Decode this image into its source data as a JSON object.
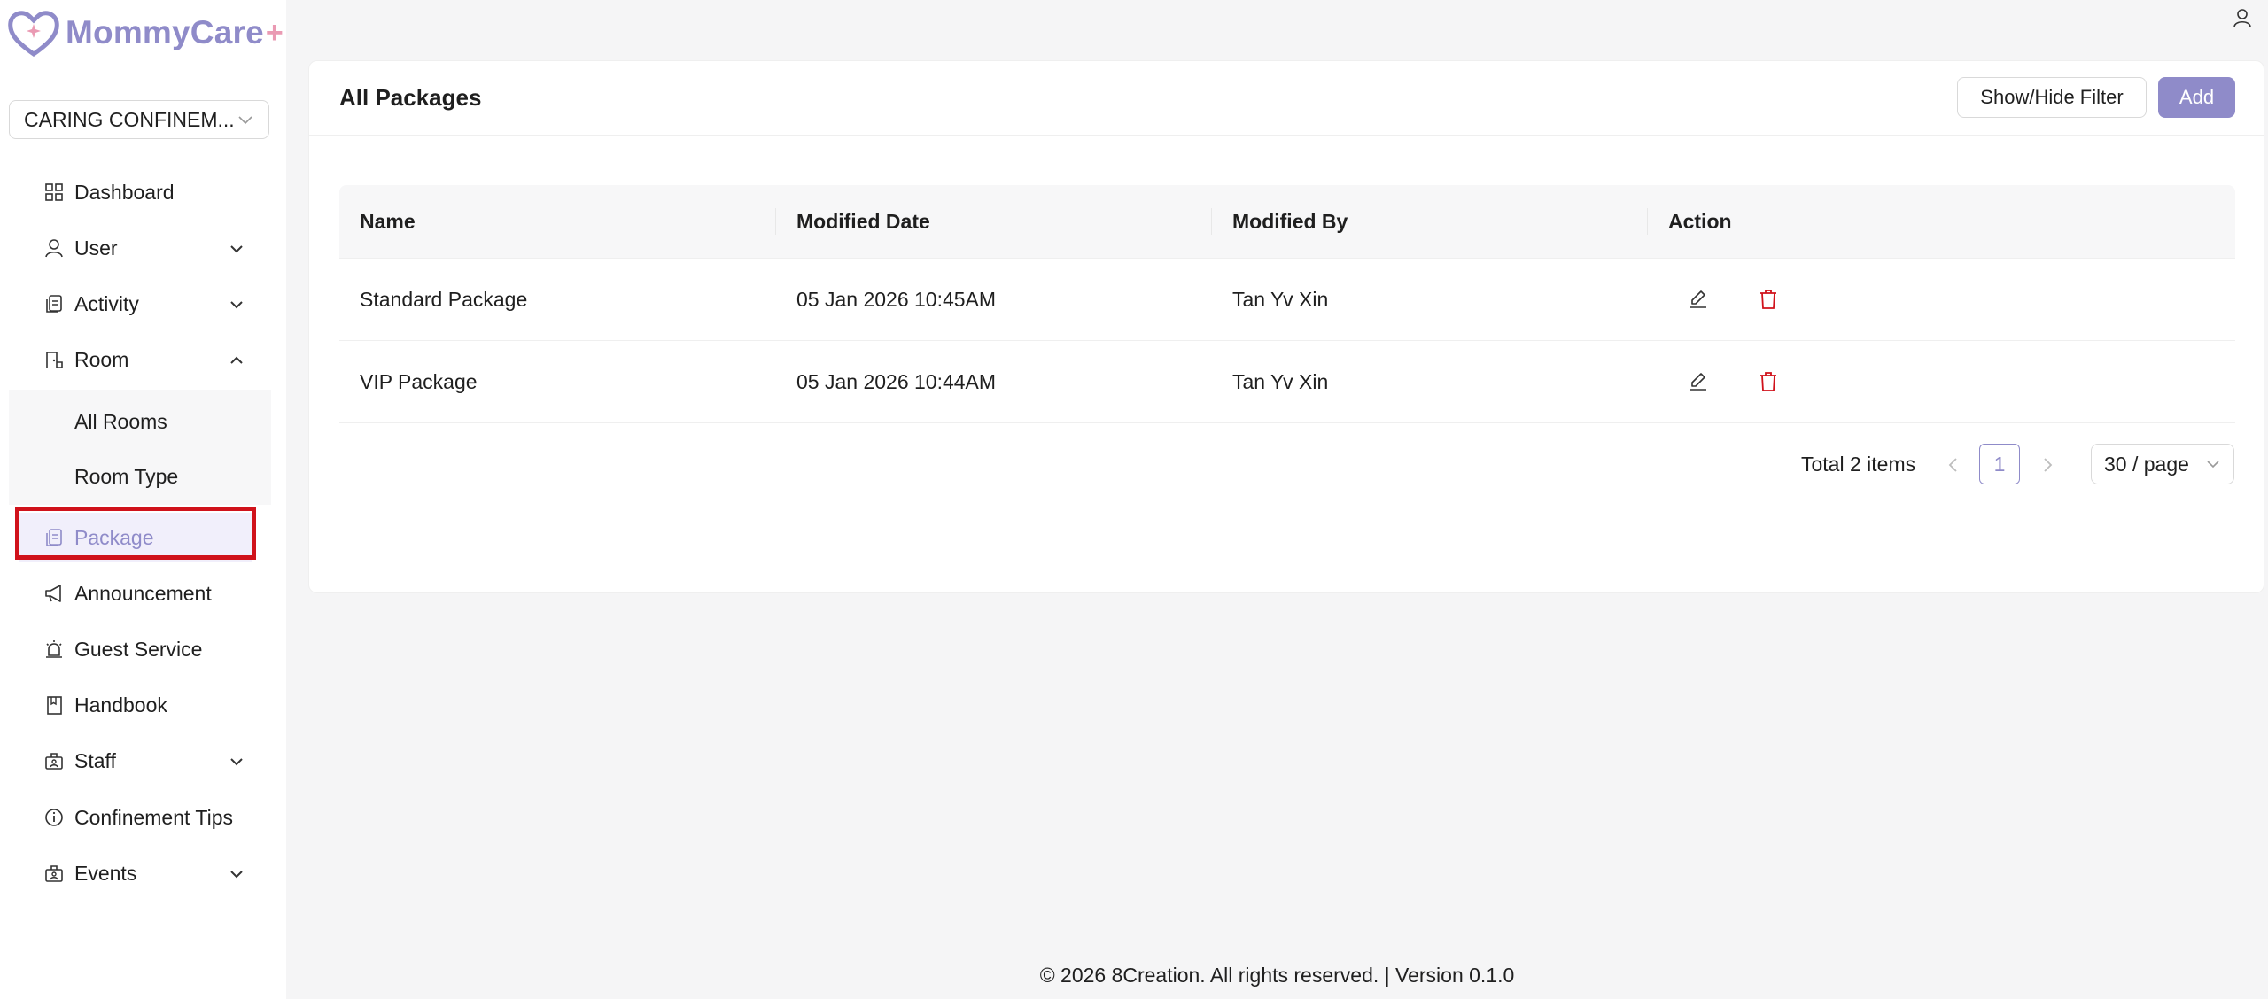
{
  "app": {
    "brand_name": "MommyCare",
    "brand_plus": "+",
    "accent_color": "#8f8bc9",
    "danger_color": "#d0121b"
  },
  "org_selector": {
    "value": "CARING CONFINEM..."
  },
  "sidebar": {
    "items": [
      {
        "label": "Dashboard",
        "icon": "dashboard-icon"
      },
      {
        "label": "User",
        "icon": "user-icon",
        "expand": "collapsed"
      },
      {
        "label": "Activity",
        "icon": "activity-icon",
        "expand": "collapsed"
      },
      {
        "label": "Room",
        "icon": "room-icon",
        "expand": "expanded",
        "children": [
          {
            "label": "All Rooms"
          },
          {
            "label": "Room Type"
          }
        ]
      },
      {
        "label": "Package",
        "icon": "package-icon",
        "selected": true
      },
      {
        "label": "Announcement",
        "icon": "megaphone-icon"
      },
      {
        "label": "Guest Service",
        "icon": "alarm-icon"
      },
      {
        "label": "Handbook",
        "icon": "book-icon"
      },
      {
        "label": "Staff",
        "icon": "staff-icon",
        "expand": "collapsed"
      },
      {
        "label": "Confinement Tips",
        "icon": "info-icon"
      },
      {
        "label": "Events",
        "icon": "events-icon",
        "expand": "collapsed"
      }
    ]
  },
  "header": {
    "account_icon": "user-icon"
  },
  "main": {
    "title": "All Packages",
    "filter_button": "Show/Hide Filter",
    "add_button": "Add",
    "table": {
      "columns": [
        "Name",
        "Modified Date",
        "Modified By",
        "Action"
      ],
      "rows": [
        {
          "name": "Standard Package",
          "modified_date": "05 Jan 2026 10:45AM",
          "modified_by": "Tan Yv Xin"
        },
        {
          "name": "VIP Package",
          "modified_date": "05 Jan 2026 10:44AM",
          "modified_by": "Tan Yv Xin"
        }
      ]
    },
    "pagination": {
      "total_text": "Total 2 items",
      "current_page": "1",
      "page_size": "30 / page"
    }
  },
  "footer": {
    "text": "© 2026 8Creation. All rights reserved. | Version 0.1.0"
  }
}
